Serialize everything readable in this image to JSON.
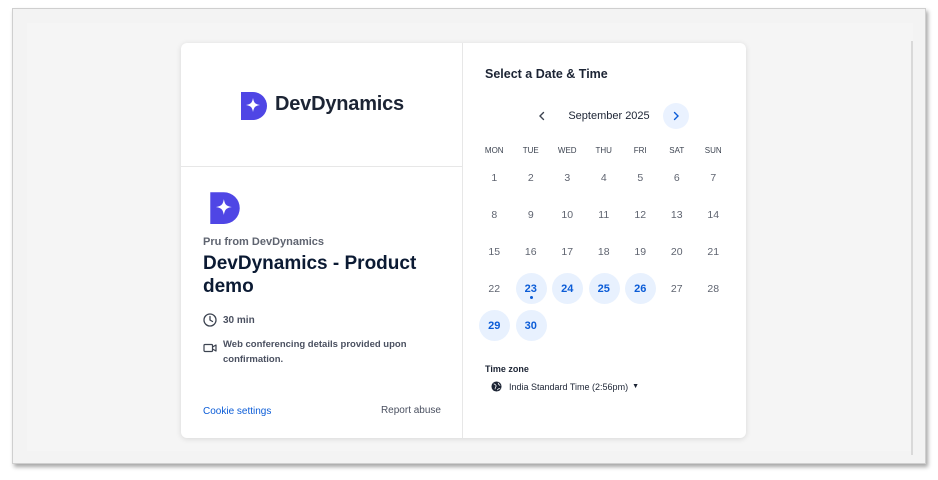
{
  "brand": {
    "name": "DevDynamics",
    "logo_icon": "devdynamics-logo-icon",
    "brand_color": "#4f46e5"
  },
  "event": {
    "host": "Pru from DevDynamics",
    "title": "DevDynamics - Product demo",
    "duration": "30 min",
    "conferencing": "Web conferencing details provided upon confirmation."
  },
  "footer": {
    "cookie_settings": "Cookie settings",
    "report_abuse": "Report abuse"
  },
  "calendar": {
    "title": "Select a Date & Time",
    "month": "September 2025",
    "weekdays": [
      "MON",
      "TUE",
      "WED",
      "THU",
      "FRI",
      "SAT",
      "SUN"
    ],
    "weeks": [
      [
        {
          "d": "1"
        },
        {
          "d": "2"
        },
        {
          "d": "3"
        },
        {
          "d": "4"
        },
        {
          "d": "5"
        },
        {
          "d": "6"
        },
        {
          "d": "7"
        }
      ],
      [
        {
          "d": "8"
        },
        {
          "d": "9"
        },
        {
          "d": "10"
        },
        {
          "d": "11"
        },
        {
          "d": "12"
        },
        {
          "d": "13"
        },
        {
          "d": "14"
        }
      ],
      [
        {
          "d": "15"
        },
        {
          "d": "16"
        },
        {
          "d": "17"
        },
        {
          "d": "18"
        },
        {
          "d": "19"
        },
        {
          "d": "20"
        },
        {
          "d": "21"
        }
      ],
      [
        {
          "d": "22"
        },
        {
          "d": "23",
          "available": true,
          "today": true
        },
        {
          "d": "24",
          "available": true
        },
        {
          "d": "25",
          "available": true
        },
        {
          "d": "26",
          "available": true
        },
        {
          "d": "27"
        },
        {
          "d": "28"
        }
      ],
      [
        {
          "d": "29",
          "available": true
        },
        {
          "d": "30",
          "available": true
        }
      ]
    ],
    "accent_color": "#0b5cd7"
  },
  "timezone": {
    "label": "Time zone",
    "value": "India Standard Time (2:56pm)"
  }
}
